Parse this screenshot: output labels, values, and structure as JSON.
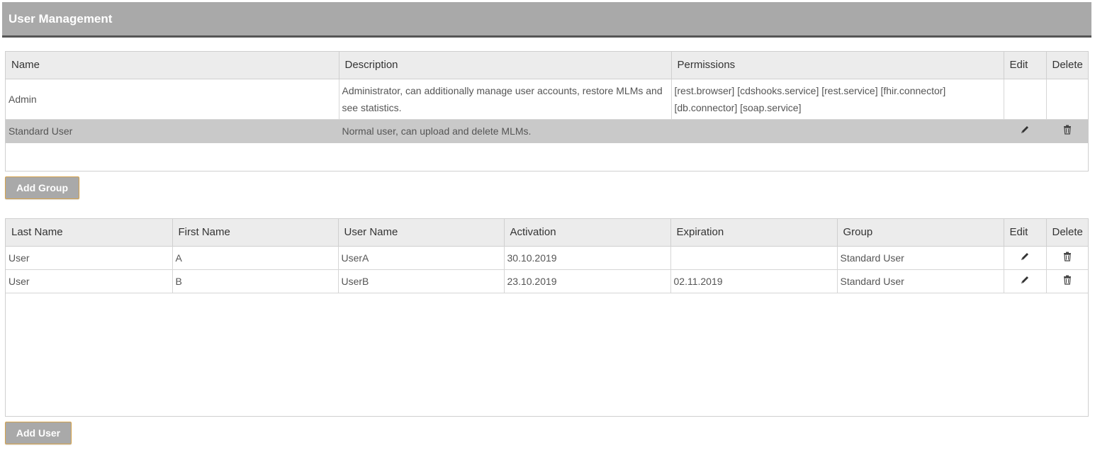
{
  "header": {
    "title": "User Management"
  },
  "groups": {
    "columns": [
      "Name",
      "Description",
      "Permissions",
      "Edit",
      "Delete"
    ],
    "rows": [
      {
        "name": "Admin",
        "description": "Administrator, can additionally manage user accounts, restore MLMs and see statistics.",
        "permissions": "[rest.browser] [cdshooks.service] [rest.service] [fhir.connector] [db.connector] [soap.service]"
      },
      {
        "name": "Standard User",
        "description": "Normal user, can upload and delete MLMs.",
        "permissions": ""
      }
    ],
    "add_label": "Add Group"
  },
  "users": {
    "columns": [
      "Last Name",
      "First Name",
      "User Name",
      "Activation",
      "Expiration",
      "Group",
      "Edit",
      "Delete"
    ],
    "rows": [
      {
        "last_name": "User",
        "first_name": "A",
        "user_name": "UserA",
        "activation": "30.10.2019",
        "expiration": "",
        "group": "Standard User"
      },
      {
        "last_name": "User",
        "first_name": "B",
        "user_name": "UserB",
        "activation": "23.10.2019",
        "expiration": "02.11.2019",
        "group": "Standard User"
      }
    ],
    "add_label": "Add User"
  },
  "icons": {
    "edit": "pencil-icon",
    "delete": "trash-icon"
  },
  "colors": {
    "header_bg": "#a9a9a9",
    "selected_row": "#c9c9c9",
    "button_border": "#d4a24b"
  }
}
